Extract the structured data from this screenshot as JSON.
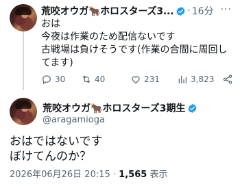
{
  "reply": {
    "display_name": "荒咬オウガ🐂ホロスターズ3...",
    "time": "16分",
    "lines": [
      "おは",
      "今夜は作業のため配信ないです",
      "古戦場は負けそうです(作業の合間に周回し",
      "てます)"
    ],
    "counts": {
      "replies": "30",
      "reposts": "40",
      "likes": "231",
      "views": "3,823"
    }
  },
  "tweet": {
    "display_name": "荒咬オウガ🐂ホロスターズ3期生",
    "handle": "@aragamioga",
    "lines": [
      "おはではないです",
      "ぼけてんのか？"
    ],
    "timestamp": "2026年06月26日 20:15",
    "views_count": "1,565",
    "views_label": "表示"
  },
  "colors": {
    "verified": "#1d9bf0",
    "muted": "#536471"
  }
}
